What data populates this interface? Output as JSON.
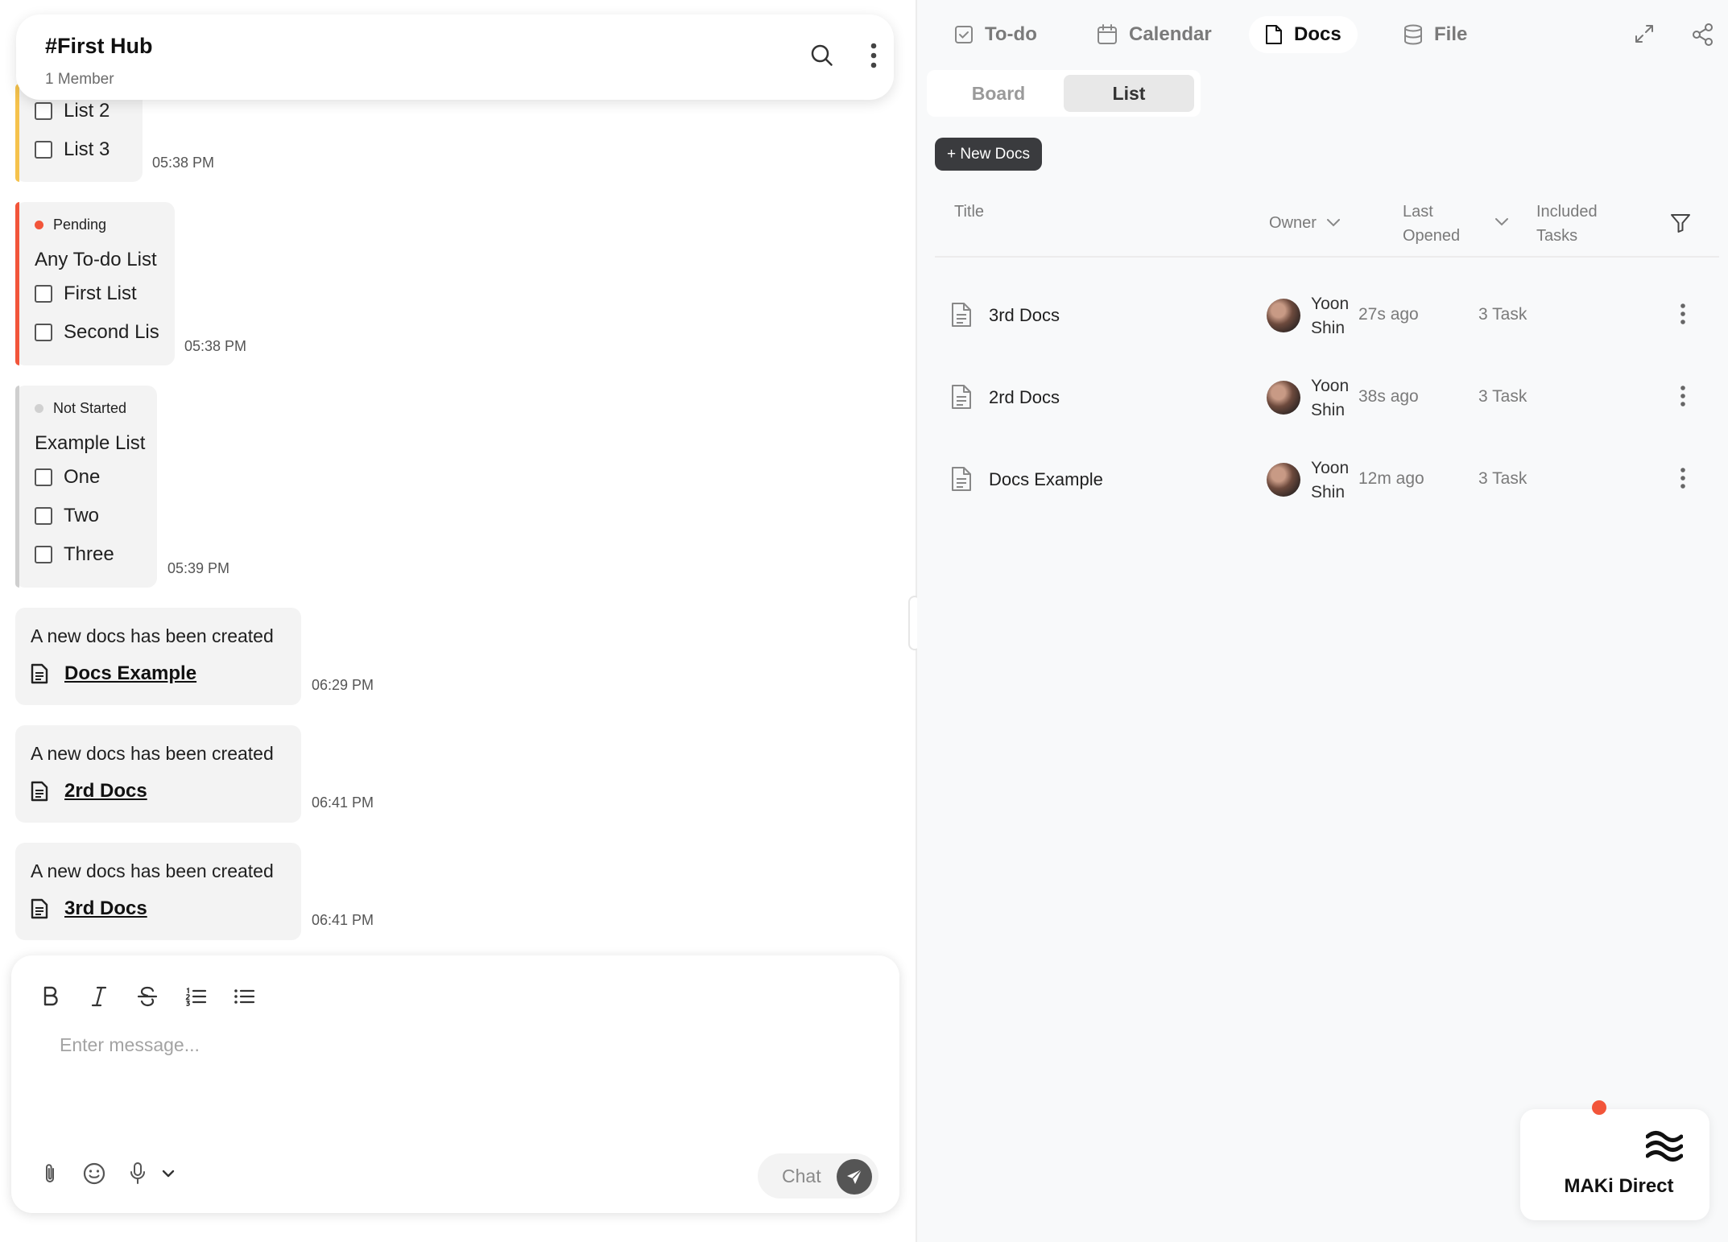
{
  "hub": {
    "title": "#First Hub",
    "members": "1 Member"
  },
  "chat": {
    "list_card_top": {
      "items": [
        "List 2",
        "List 3"
      ],
      "time": "05:38 PM",
      "accent": "#f5c24c"
    },
    "pending_card": {
      "status": "Pending",
      "status_color": "#f2553a",
      "title": "Any To-do List",
      "items": [
        "First List",
        "Second Lis"
      ],
      "time": "05:38 PM",
      "accent": "#f2553a"
    },
    "notstarted_card": {
      "status": "Not Started",
      "status_color": "#d0d0d0",
      "title": "Example List",
      "items": [
        "One",
        "Two",
        "Three"
      ],
      "time": "05:39 PM",
      "accent": "#cfcfcf"
    },
    "doc_messages": [
      {
        "text": "A new docs has been created",
        "link": "Docs Example",
        "time": "06:29 PM"
      },
      {
        "text": "A new docs has been created",
        "link": "2rd Docs",
        "time": "06:41 PM"
      },
      {
        "text": "A new docs has been created",
        "link": "3rd Docs",
        "time": "06:41 PM"
      }
    ]
  },
  "composer": {
    "placeholder": "Enter message...",
    "send_label": "Chat",
    "format_icons": [
      "bold-icon",
      "italic-icon",
      "strikethrough-icon",
      "ordered-list-icon",
      "bullet-list-icon"
    ],
    "tool_icons": [
      "paperclip-icon",
      "emoji-icon",
      "microphone-icon",
      "chevron-down-icon"
    ]
  },
  "tabs": [
    {
      "label": "To-do",
      "icon": "checkbox-icon",
      "active": false
    },
    {
      "label": "Calendar",
      "icon": "calendar-icon",
      "active": false
    },
    {
      "label": "Docs",
      "icon": "document-icon",
      "active": true
    },
    {
      "label": "File",
      "icon": "database-icon",
      "active": false
    }
  ],
  "view_toggle": {
    "options": [
      "Board",
      "List"
    ],
    "selected": "List"
  },
  "new_docs_label": "+ New Docs",
  "table": {
    "headers": {
      "title": "Title",
      "owner": "Owner",
      "last_opened_1": "Last",
      "last_opened_2": "Opened",
      "tasks_1": "Included",
      "tasks_2": "Tasks"
    },
    "rows": [
      {
        "title": "3rd Docs",
        "owner_first": "Yoon",
        "owner_last": "Shin",
        "opened": "27s ago",
        "tasks": "3 Task"
      },
      {
        "title": "2rd Docs",
        "owner_first": "Yoon",
        "owner_last": "Shin",
        "opened": "38s ago",
        "tasks": "3 Task"
      },
      {
        "title": "Docs Example",
        "owner_first": "Yoon",
        "owner_last": "Shin",
        "opened": "12m ago",
        "tasks": "3 Task"
      }
    ]
  },
  "maki": {
    "label": "MAKi Direct",
    "notification_color": "#f2553a"
  }
}
